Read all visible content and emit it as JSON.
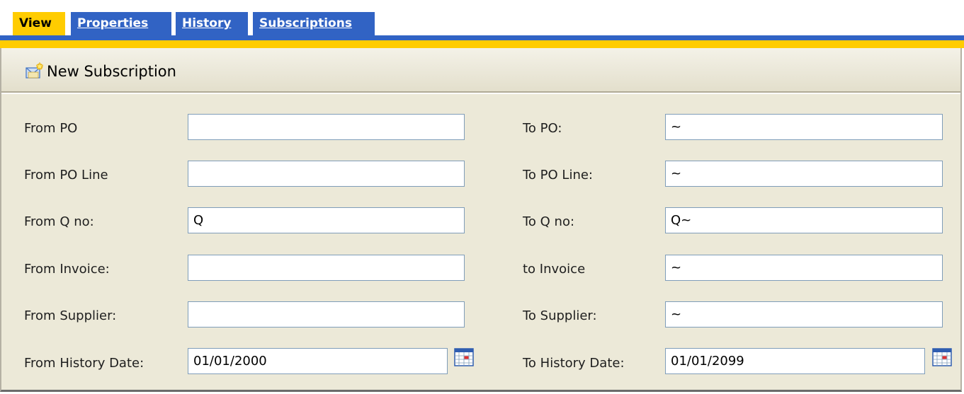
{
  "tabs": [
    {
      "label": "View",
      "active": true
    },
    {
      "label": "Properties",
      "active": false
    },
    {
      "label": "History",
      "active": false
    },
    {
      "label": "Subscriptions",
      "active": false
    }
  ],
  "toolbar": {
    "new_subscription_label": "New Subscription",
    "icon": "new-subscription-icon"
  },
  "form": {
    "from_po": {
      "label": "From PO",
      "value": ""
    },
    "to_po": {
      "label": "To PO:",
      "value": "~"
    },
    "from_po_line": {
      "label": "From PO Line",
      "value": ""
    },
    "to_po_line": {
      "label": "To PO Line:",
      "value": "~"
    },
    "from_q_no": {
      "label": "From Q no:",
      "value": "Q"
    },
    "to_q_no": {
      "label": "To Q no:",
      "value": "Q~"
    },
    "from_invoice": {
      "label": "From Invoice:",
      "value": ""
    },
    "to_invoice": {
      "label": "to Invoice",
      "value": "~"
    },
    "from_supplier": {
      "label": "From Supplier:",
      "value": ""
    },
    "to_supplier": {
      "label": "To Supplier:",
      "value": "~"
    },
    "from_history_date": {
      "label": "From History Date:",
      "value": "01/01/2000"
    },
    "to_history_date": {
      "label": "To History Date:",
      "value": "01/01/2099"
    }
  },
  "colors": {
    "tab_active": "#ffcc00",
    "tab_inactive": "#3163c4",
    "panel_bg": "#ece9d8"
  }
}
